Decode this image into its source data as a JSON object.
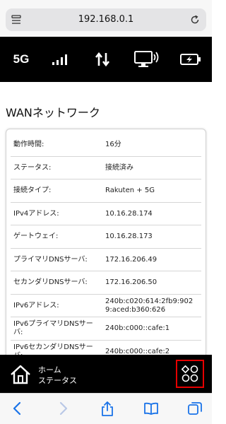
{
  "browser": {
    "url": "192.168.0.1"
  },
  "status_bar": {
    "network_type": "5G",
    "icons": [
      "signal-bars-icon",
      "data-transfer-icon",
      "wifi-device-icon",
      "battery-charging-icon"
    ]
  },
  "page": {
    "title": "WANネットワーク",
    "rows": [
      {
        "label": "動作時間:",
        "value": "16分"
      },
      {
        "label": "ステータス:",
        "value": "接続済み"
      },
      {
        "label": "接続タイプ:",
        "value": "Rakuten + 5G"
      },
      {
        "label": "IPv4アドレス:",
        "value": "10.16.28.174"
      },
      {
        "label": "ゲートウェイ:",
        "value": "10.16.28.173"
      },
      {
        "label": "プライマリDNSサーバ:",
        "value": "172.16.206.49"
      },
      {
        "label": "セカンダリDNSサーバ:",
        "value": "172.16.206.50"
      },
      {
        "label": "IPv6アドレス:",
        "value": "240b:c020:614:2fb9:9029:aced:b360:626"
      },
      {
        "label": "IPv6プライマリDNSサーバ:",
        "value": "240b:c000::cafe:1"
      },
      {
        "label": "IPv6セカンダリDNSサーバ:",
        "value": "240b:c000::cafe:2"
      }
    ]
  },
  "bottom_nav": {
    "home_label": "ホーム",
    "status_label": "ステータス",
    "menu_icon": "apps-grid-icon",
    "highlight_color": "#e60000"
  },
  "toolbar": {
    "icons": [
      "back-icon",
      "forward-icon",
      "share-icon",
      "bookmarks-icon",
      "tabs-icon"
    ]
  }
}
